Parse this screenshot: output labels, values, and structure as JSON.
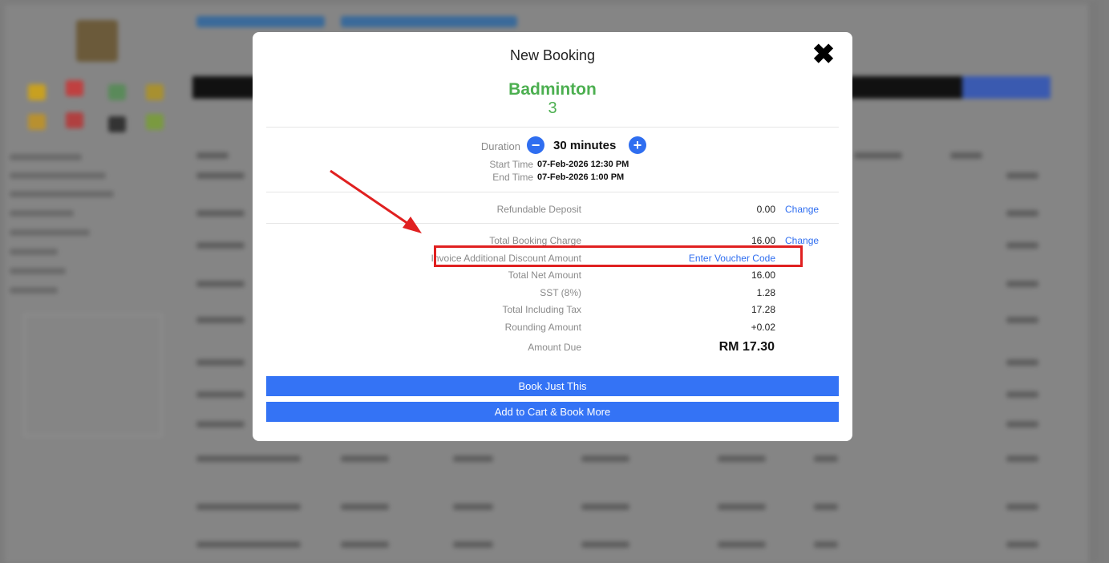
{
  "modal": {
    "title": "New Booking",
    "facility": "Badminton",
    "court": "3",
    "close_icon": "close-icon"
  },
  "duration": {
    "label": "Duration",
    "value": "30 minutes",
    "minus_icon": "minus-circle-icon",
    "plus_icon": "plus-circle-icon"
  },
  "times": {
    "start_label": "Start Time",
    "start_value": "07-Feb-2026 12:30 PM",
    "end_label": "End Time",
    "end_value": "07-Feb-2026 1:00 PM"
  },
  "deposit": {
    "label": "Refundable Deposit",
    "value": "0.00",
    "change_label": "Change"
  },
  "charges": {
    "total_booking_charge_label": "Total Booking Charge",
    "total_booking_charge_value": "16.00",
    "change_label": "Change",
    "discount_label": "Invoice Additional Discount Amount",
    "voucher_link": "Enter Voucher Code",
    "net_label": "Total Net Amount",
    "net_value": "16.00",
    "sst_label": "SST (8%)",
    "sst_value": "1.28",
    "incl_tax_label": "Total Including Tax",
    "incl_tax_value": "17.28",
    "rounding_label": "Rounding Amount",
    "rounding_value": "+0.02",
    "due_label": "Amount Due",
    "due_value": "RM 17.30"
  },
  "actions": {
    "book_just_this": "Book Just This",
    "add_to_cart": "Add to Cart & Book More"
  },
  "colors": {
    "accent_blue": "#3473f5",
    "facility_green": "#4caf50",
    "highlight_red": "#e02020"
  }
}
